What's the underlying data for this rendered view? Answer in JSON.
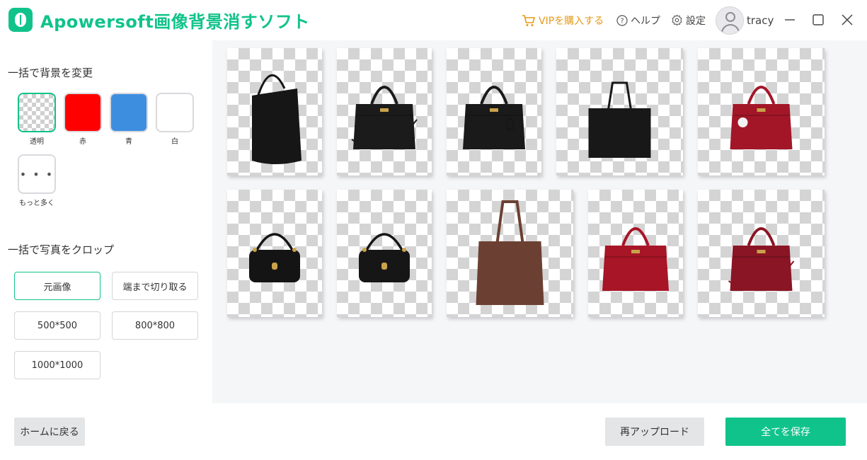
{
  "app": {
    "title": "Apowersoft画像背景消すソフト",
    "accent_color": "#10c38a"
  },
  "header": {
    "vip_label": "VIPを購入する",
    "help_label": "ヘルプ",
    "settings_label": "設定",
    "username": "tracy"
  },
  "sidebar": {
    "background_title": "一括で背景を変更",
    "backgrounds": [
      {
        "label": "透明",
        "color": "transparent",
        "selected": true
      },
      {
        "label": "赤",
        "color": "#ff0000",
        "selected": false
      },
      {
        "label": "青",
        "color": "#3e8ee0",
        "selected": false
      },
      {
        "label": "白",
        "color": "#ffffff",
        "selected": false
      }
    ],
    "more_label": "もっと多く",
    "more_symbol": "• • •",
    "crop_title": "一括で写真をクロップ",
    "crop_options": [
      {
        "label": "元画像",
        "selected": true
      },
      {
        "label": "端まで切り取る",
        "selected": false
      },
      {
        "label": "500*500",
        "selected": false
      },
      {
        "label": "800*800",
        "selected": false
      },
      {
        "label": "1000*1000",
        "selected": false
      }
    ]
  },
  "gallery": {
    "items": [
      {
        "kind": "hobo",
        "color": "#161616"
      },
      {
        "kind": "satchel",
        "color": "#1b1b1b"
      },
      {
        "kind": "satchel-tag",
        "color": "#1a1a1a"
      },
      {
        "kind": "tote-square",
        "color": "#181818"
      },
      {
        "kind": "satchel-charm",
        "color": "#a31628"
      },
      {
        "kind": "baguette",
        "color": "#141414"
      },
      {
        "kind": "baguette",
        "color": "#161616"
      },
      {
        "kind": "tote-tall",
        "color": "#6b4032"
      },
      {
        "kind": "satchel-boxy",
        "color": "#a71526"
      },
      {
        "kind": "satchel-strap",
        "color": "#8a1524"
      }
    ]
  },
  "footer": {
    "home_label": "ホームに戻る",
    "reupload_label": "再アップロード",
    "save_all_label": "全てを保存"
  }
}
